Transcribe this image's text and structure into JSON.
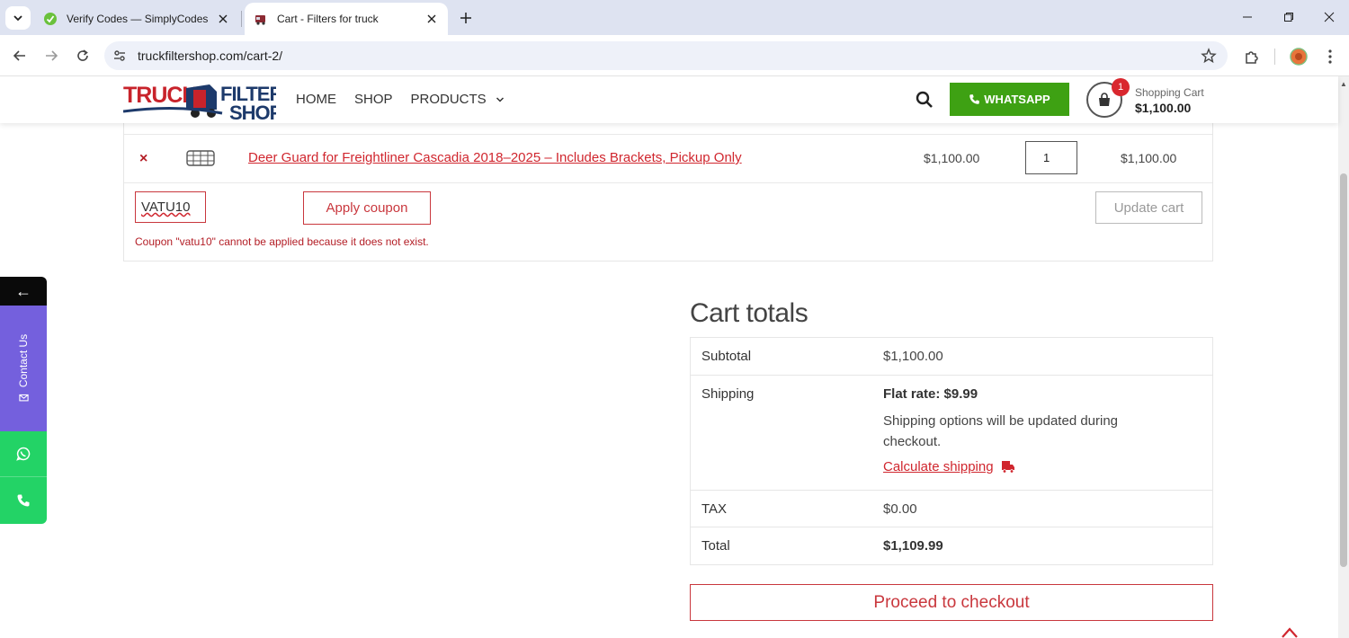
{
  "browser": {
    "tabs": [
      {
        "title": "Verify Codes — SimplyCodes",
        "active": false
      },
      {
        "title": "Cart - Filters for truck",
        "active": true
      }
    ],
    "url": "truckfiltershop.com/cart-2/"
  },
  "header": {
    "logo_text_1": "TRUCK",
    "logo_text_2": "FILTER",
    "logo_text_3": "SHOP",
    "nav": {
      "home": "HOME",
      "shop": "SHOP",
      "products": "PRODUCTS"
    },
    "whatsapp_label": "WHATSAPP",
    "cart_count": "1",
    "cart_label": "Shopping Cart",
    "cart_total": "$1,100.00"
  },
  "cart": {
    "item": {
      "remove": "×",
      "name": "Deer Guard for Freightliner Cascadia 2018–2025 – Includes Brackets, Pickup Only",
      "price": "$1,100.00",
      "quantity": "1",
      "subtotal": "$1,100.00"
    },
    "coupon_value": "VATU10",
    "apply_label": "Apply coupon",
    "update_label": "Update cart",
    "coupon_error": "Coupon \"vatu10\" cannot be applied because it does not exist."
  },
  "totals": {
    "title": "Cart totals",
    "subtotal_label": "Subtotal",
    "subtotal_value": "$1,100.00",
    "shipping_label": "Shipping",
    "shipping_rate": "Flat rate: $9.99",
    "shipping_note": "Shipping options will be updated during checkout.",
    "calc_shipping": "Calculate shipping",
    "tax_label": "TAX",
    "tax_value": "$0.00",
    "total_label": "Total",
    "total_value": "$1,109.99",
    "checkout_label": "Proceed to checkout"
  },
  "side_widget": {
    "back_arrow": "←",
    "contact_label": "Contact Us"
  },
  "colors": {
    "accent_red": "#d0262e",
    "whatsapp_green": "#3ea113",
    "contact_purple": "#7460dd"
  }
}
